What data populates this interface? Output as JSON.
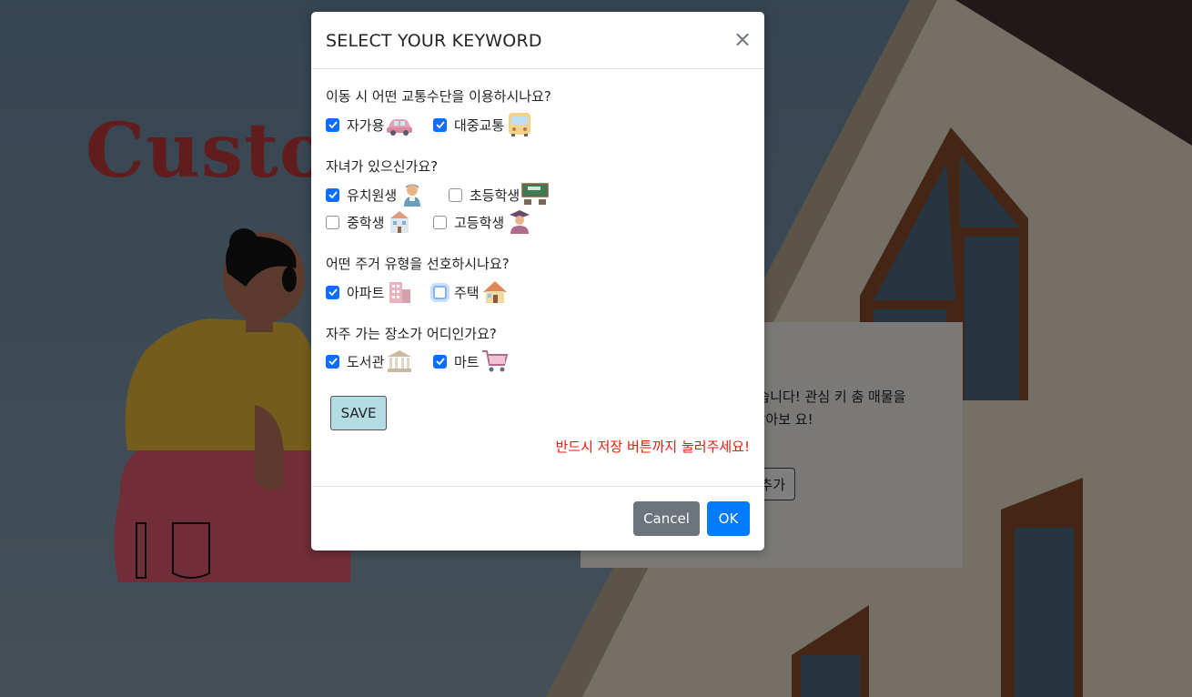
{
  "background": {
    "title": "Custom",
    "card_text": "가 없습니다! 관심 키 춤 매물을 추천받아보 요!",
    "card_button": "추가"
  },
  "modal": {
    "title": "SELECT YOUR KEYWORD",
    "close_label": "×",
    "questions": [
      {
        "text": "이동 시 어떤 교통수단을 이용하시나요?",
        "options": [
          {
            "label": "자가용",
            "checked": true,
            "icon": "car-icon"
          },
          {
            "label": "대중교통",
            "checked": true,
            "icon": "bus-icon"
          }
        ]
      },
      {
        "text": "자녀가 있으신가요?",
        "options": [
          {
            "label": "유치원생",
            "checked": true,
            "icon": "child-icon"
          },
          {
            "label": "초등학생",
            "checked": false,
            "icon": "blackboard-icon"
          },
          {
            "label": "중학생",
            "checked": false,
            "icon": "school-building-icon"
          },
          {
            "label": "고등학생",
            "checked": false,
            "icon": "graduate-icon"
          }
        ]
      },
      {
        "text": "어떤 주거 유형을 선호하시나요?",
        "options": [
          {
            "label": "아파트",
            "checked": true,
            "icon": "apartment-icon"
          },
          {
            "label": "주택",
            "checked": false,
            "icon": "house-icon"
          }
        ]
      },
      {
        "text": "자주 가는 장소가 어디인가요?",
        "options": [
          {
            "label": "도서관",
            "checked": true,
            "icon": "library-icon"
          },
          {
            "label": "마트",
            "checked": true,
            "icon": "shopping-cart-icon"
          }
        ]
      }
    ],
    "save_label": "SAVE",
    "warning": "반드시 저장 버튼까지 눌러주세요!",
    "cancel_label": "Cancel",
    "ok_label": "OK"
  },
  "colors": {
    "primary": "#007bff",
    "secondary": "#6c757d",
    "save_button": "#b2dbe3",
    "warning_text": "#e8190e"
  }
}
